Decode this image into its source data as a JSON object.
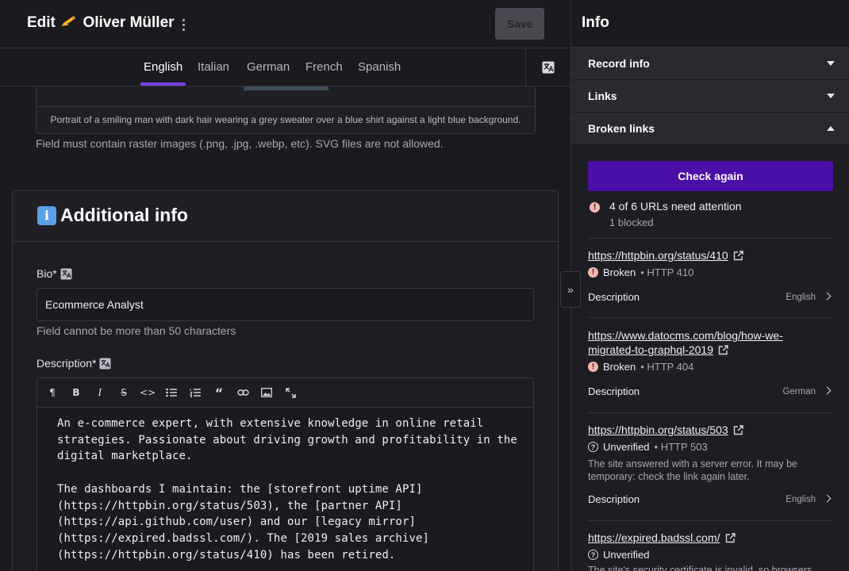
{
  "header": {
    "edit_prefix": "Edit",
    "record_name": "Oliver Müller",
    "save_label": "Save"
  },
  "locales": [
    "English",
    "Italian",
    "German",
    "French",
    "Spanish"
  ],
  "active_locale": "English",
  "image_field": {
    "alt_text": "Portrait of a smiling man with dark hair wearing a grey sweater over a blue shirt against a light blue background.",
    "hint": "Field must contain raster images (.png, .jpg, .webp, etc). SVG files are not allowed."
  },
  "section": {
    "title": "Additional info",
    "bio_label": "Bio*",
    "bio_value": "Ecommerce Analyst",
    "bio_hint": "Field cannot be more than 50 characters",
    "description_label": "Description*",
    "description_text": "An e-commerce expert, with extensive knowledge in online retail\nstrategies. Passionate about driving growth and profitability in the\ndigital marketplace.\n\nThe dashboards I maintain: the [storefront uptime API]\n(https://httpbin.org/status/503), the [partner API]\n(https://api.github.com/user) and our [legacy mirror]\n(https://expired.badssl.com/). The [2019 sales archive]\n(https://httpbin.org/status/410) has been retired."
  },
  "sidebar": {
    "title": "Info",
    "accordions": [
      {
        "label": "Record info",
        "expanded": false
      },
      {
        "label": "Links",
        "expanded": false
      },
      {
        "label": "Broken links",
        "expanded": true
      }
    ],
    "check_again_label": "Check again",
    "summary": "4 of 6 URLs need attention",
    "summary_sub": "1 blocked",
    "links": [
      {
        "url": "https://httpbin.org/status/410",
        "status": "Broken",
        "detail": "• HTTP 410",
        "field": "Description",
        "locale": "English"
      },
      {
        "url_line1": "https://www.datocms.com/blog/how-we-",
        "url_line2": "migrated-to-graphql-2019",
        "status": "Broken",
        "detail": "• HTTP 404",
        "field": "Description",
        "locale": "German"
      },
      {
        "url": "https://httpbin.org/status/503",
        "status": "Unverified",
        "detail": "• HTTP 503",
        "note": "The site answered with a server error. It may be temporary: check the link again later.",
        "field": "Description",
        "locale": "English"
      },
      {
        "url": "https://expired.badssl.com/",
        "status": "Unverified",
        "note": "The site's security certificate is invalid, so browsers"
      }
    ]
  }
}
